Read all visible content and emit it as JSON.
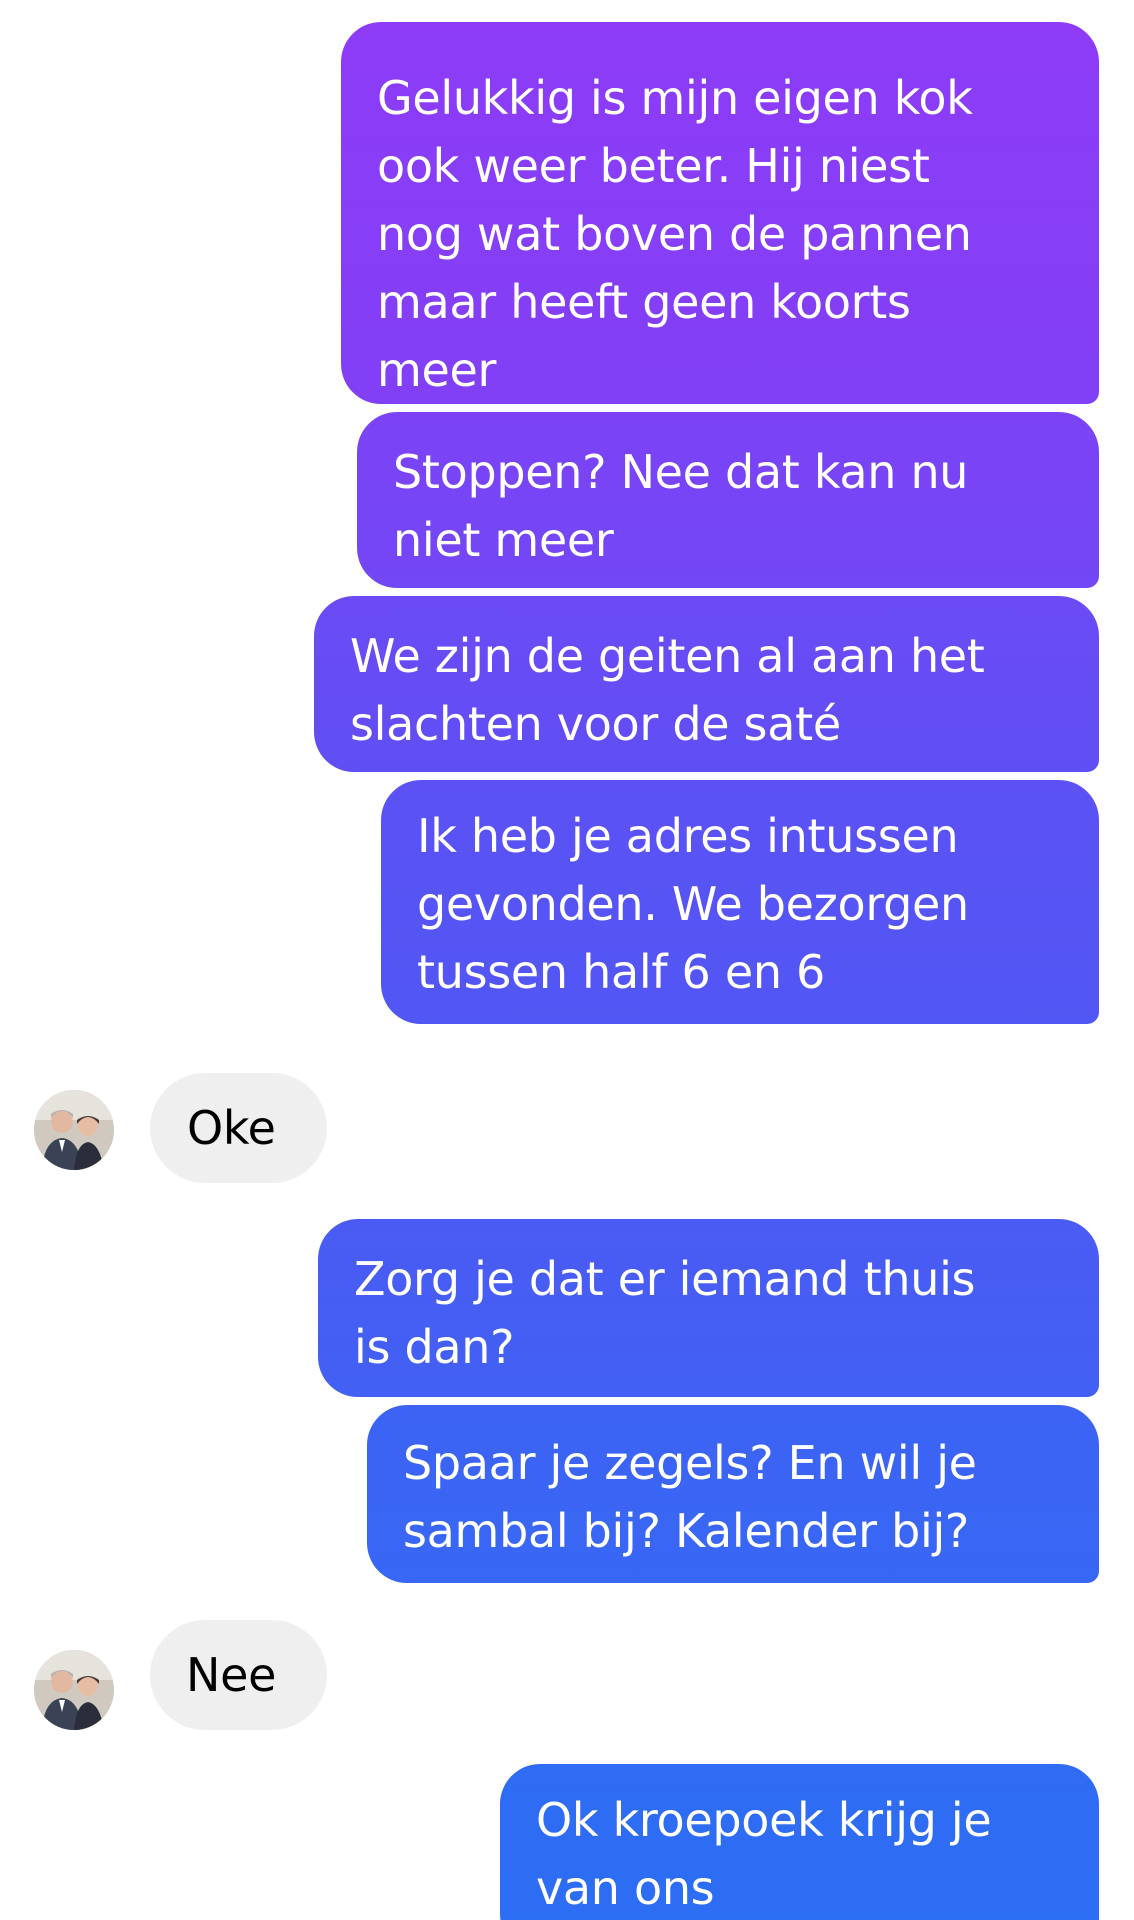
{
  "conversation": {
    "messages": [
      {
        "from": "me",
        "text": "Gelukkig is mijn eigen kok\nook weer beter. Hij niest\nnog wat boven de pannen\nmaar heeft geen koorts\nmeer"
      },
      {
        "from": "me",
        "text": "Stoppen? Nee dat kan nu\nniet meer"
      },
      {
        "from": "me",
        "text": "We zijn de geiten al aan het\nslachten voor de saté"
      },
      {
        "from": "me",
        "text": "Ik heb je adres intussen\ngevonden. We bezorgen\ntussen half 6 en 6"
      },
      {
        "from": "contact",
        "text": "Oke"
      },
      {
        "from": "me",
        "text": "Zorg je dat er iemand thuis\nis dan?"
      },
      {
        "from": "me",
        "text": "Spaar je zegels? En wil je\nsambal bij? Kalender bij?"
      },
      {
        "from": "contact",
        "text": "Nee"
      },
      {
        "from": "me",
        "text": "Ok kroepoek krijg je\nvan ons"
      }
    ]
  },
  "colors": {
    "gradient_top": "#8e3bf7",
    "gradient_bottom": "#2f6bf3",
    "received_bg": "#efefef"
  },
  "icons": {
    "contact_avatar": "avatar"
  }
}
